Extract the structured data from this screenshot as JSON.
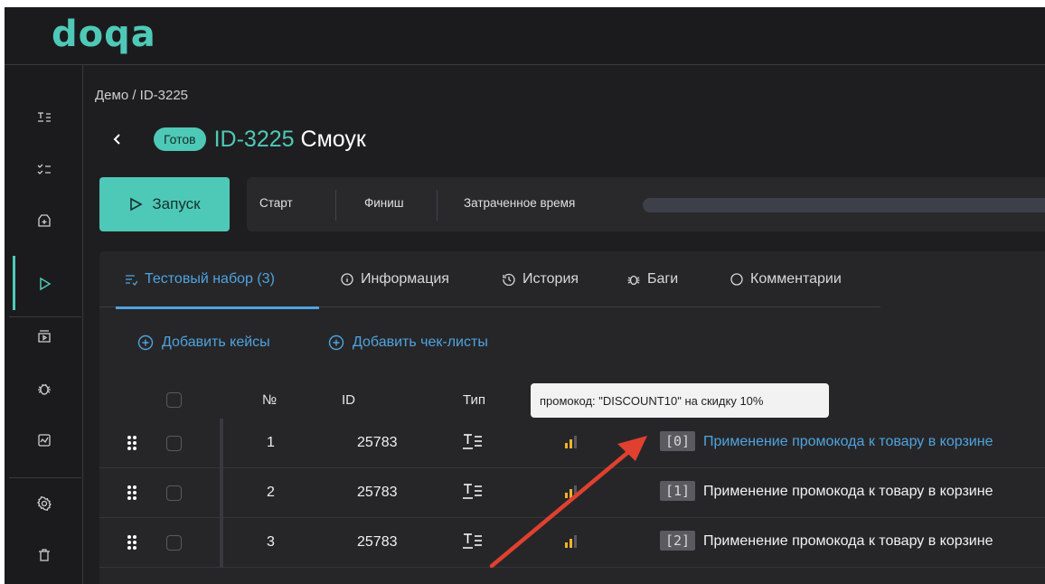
{
  "app": {
    "logo": "doqa"
  },
  "breadcrumb": "Демо / ID-3225",
  "header": {
    "status": "Готов",
    "id": "ID-3225",
    "title": "Смоук"
  },
  "run": {
    "button_label": "Запуск",
    "start_label": "Старт",
    "finish_label": "Финиш",
    "elapsed_label": "Затраченное время"
  },
  "tabs": [
    {
      "label": "Тестовый набор (3)",
      "icon": "list-icon",
      "active": true
    },
    {
      "label": "Информация",
      "icon": "info-icon"
    },
    {
      "label": "История",
      "icon": "history-icon"
    },
    {
      "label": "Баги",
      "icon": "bug-icon"
    },
    {
      "label": "Комментарии",
      "icon": "comment-icon"
    }
  ],
  "actions": {
    "add_cases": "Добавить кейсы",
    "add_checklists": "Добавить чек-листы"
  },
  "table": {
    "headers": {
      "num": "№",
      "id": "ID",
      "type": "Тип"
    },
    "rows": [
      {
        "num": "1",
        "id": "25783",
        "index": "[0]",
        "name": "Применение промокода к товару в корзине"
      },
      {
        "num": "2",
        "id": "25783",
        "index": "[1]",
        "name": "Применение промокода к товару в корзине"
      },
      {
        "num": "3",
        "id": "25783",
        "index": "[2]",
        "name": "Применение промокода к товару в корзине"
      }
    ]
  },
  "tooltip": "промокод: \"DISCOUNT10\" на скидку 10%",
  "colors": {
    "accent": "#4fc9b7",
    "link": "#4fa3e0",
    "annotation_arrow": "#e0402f",
    "priority": "#f0b429"
  },
  "sidebar": {
    "icons": [
      "test-cases-icon",
      "checklists-icon",
      "add-icon",
      "runs-icon",
      "import-icon",
      "bugs-icon",
      "reports-icon",
      "settings-icon",
      "trash-icon"
    ],
    "active": "runs-icon"
  }
}
